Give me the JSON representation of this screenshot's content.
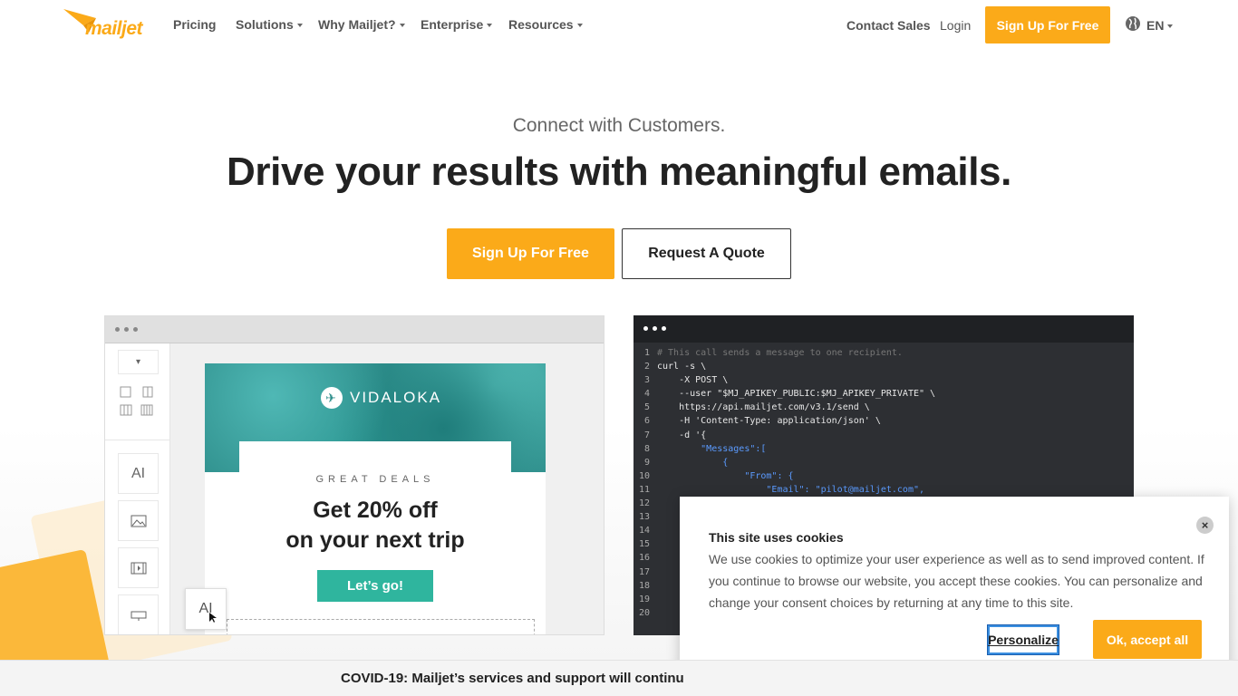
{
  "nav": {
    "logo_text": "mailjet",
    "items": [
      {
        "label": "Pricing",
        "has_caret": false
      },
      {
        "label": "Solutions",
        "has_caret": true
      },
      {
        "label": "Why Mailjet?",
        "has_caret": true
      },
      {
        "label": "Enterprise",
        "has_caret": true
      },
      {
        "label": "Resources",
        "has_caret": true
      }
    ],
    "contact_sales": "Contact Sales",
    "login": "Login",
    "signup": "Sign Up For Free",
    "language": "EN",
    "brand_color": "#FBAA19"
  },
  "hero": {
    "kicker": "Connect with Customers.",
    "headline": "Drive your results with meaningful emails.",
    "primary_cta": "Sign Up For Free",
    "secondary_cta": "Request A Quote"
  },
  "editor": {
    "brand": "VIDALOKA",
    "deals": "GREAT DEALS",
    "offer_line1": "Get 20% off",
    "offer_line2": "on your next trip",
    "button": "Let’s go!",
    "tool_text_glyph": "AI"
  },
  "code": {
    "lines": [
      {
        "n": "1",
        "text": "# This call sends a message to one recipient.",
        "kind": "comment"
      },
      {
        "n": "2",
        "text": "curl -s \\",
        "kind": "plain"
      },
      {
        "n": "3",
        "text": "    -X POST \\",
        "kind": "plain"
      },
      {
        "n": "4",
        "text": "    --user \"$MJ_APIKEY_PUBLIC:$MJ_APIKEY_PRIVATE\" \\",
        "kind": "plain"
      },
      {
        "n": "5",
        "text": "    https://api.mailjet.com/v3.1/send \\",
        "kind": "plain"
      },
      {
        "n": "6",
        "text": "    -H 'Content-Type: application/json' \\",
        "kind": "plain"
      },
      {
        "n": "7",
        "text": "    -d '{",
        "kind": "plain"
      },
      {
        "n": "8",
        "text": "        \"Messages\":[",
        "kind": "key"
      },
      {
        "n": "9",
        "text": "            {",
        "kind": "key"
      },
      {
        "n": "10",
        "text": "                \"From\": {",
        "kind": "key"
      },
      {
        "n": "11",
        "text": "                    \"Email\": \"pilot@mailjet.com\",",
        "kind": "key"
      },
      {
        "n": "12",
        "text": "",
        "kind": "plain"
      },
      {
        "n": "13",
        "text": "",
        "kind": "plain"
      },
      {
        "n": "14",
        "text": "",
        "kind": "plain"
      },
      {
        "n": "15",
        "text": "",
        "kind": "plain"
      },
      {
        "n": "16",
        "text": "",
        "kind": "plain"
      },
      {
        "n": "17",
        "text": "",
        "kind": "plain"
      },
      {
        "n": "18",
        "text": "",
        "kind": "plain"
      },
      {
        "n": "19",
        "text": "",
        "kind": "plain"
      },
      {
        "n": "20",
        "text": "",
        "kind": "plain"
      }
    ]
  },
  "cookie": {
    "title": "This site uses cookies",
    "body": "We use cookies to optimize your user experience as well as to send improved content. If you continue to browse our website, you accept these cookies. You can personalize and change your consent choices by returning at any time to this site.",
    "close": "×",
    "personalize": "Personalize",
    "accept": "Ok, accept all"
  },
  "covid": {
    "text": "COVID-19: Mailjet’s services and support will continu"
  }
}
